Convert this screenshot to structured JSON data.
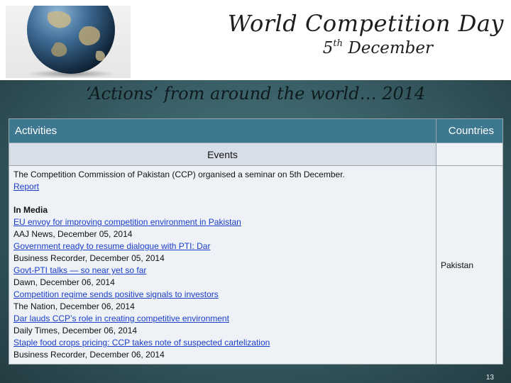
{
  "header": {
    "title": "World Competition Day",
    "date_day": "5",
    "date_suffix": "th",
    "date_month": "December"
  },
  "subtitle": "‘Actions’ from around the world… 2014",
  "table": {
    "col_activities": "Activities",
    "col_countries": "Countries",
    "events_label": "Events",
    "intro_text": "The Competition Commission of Pakistan (CCP) organised a seminar on 5th December.",
    "intro_link": "Report",
    "media_heading": "In Media",
    "media_items": [
      {
        "link": "EU envoy for improving competition environment in Pakistan",
        "source": "AAJ News, December 05, 2014"
      },
      {
        "link": "Government ready to resume dialogue with PTI: Dar",
        "source": "Business Recorder, December 05, 2014"
      },
      {
        "link": "Govt-PTI talks — so near yet so far",
        "source": "Dawn, December 06, 2014"
      },
      {
        "link": "Competition regime sends positive signals to investors",
        "source": "The Nation, December 06, 2014"
      },
      {
        "link": "Dar lauds CCP’s role in creating competitive environment",
        "source": "Daily Times, December 06, 2014"
      },
      {
        "link": "Staple food crops pricing: CCP takes note of suspected cartelization",
        "source": "Business Recorder, December 06, 2014"
      }
    ],
    "country": "Pakistan"
  },
  "page_number": "13"
}
